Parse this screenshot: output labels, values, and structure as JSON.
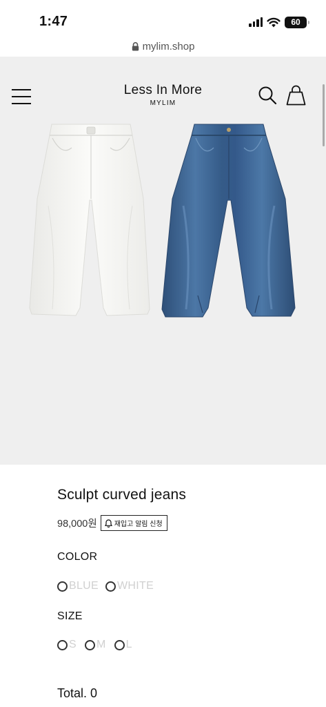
{
  "status_bar": {
    "time": "1:47",
    "battery": "60"
  },
  "browser": {
    "url": "mylim.shop"
  },
  "header": {
    "brand_name": "Less In More",
    "brand_sub": "MYLIM"
  },
  "product": {
    "title": "Sculpt curved jeans",
    "price": "98,000원",
    "restock_label": "재입고 알림 신청"
  },
  "options": {
    "color_label": "COLOR",
    "colors": [
      "BLUE",
      "WHITE"
    ],
    "size_label": "SIZE",
    "sizes": [
      "S",
      "M",
      "L"
    ]
  },
  "total": "Total. 0",
  "colors": {
    "hero_bg": "#efefef",
    "denim_blue": "#3f6a9c",
    "white_denim": "#f7f7f5"
  }
}
